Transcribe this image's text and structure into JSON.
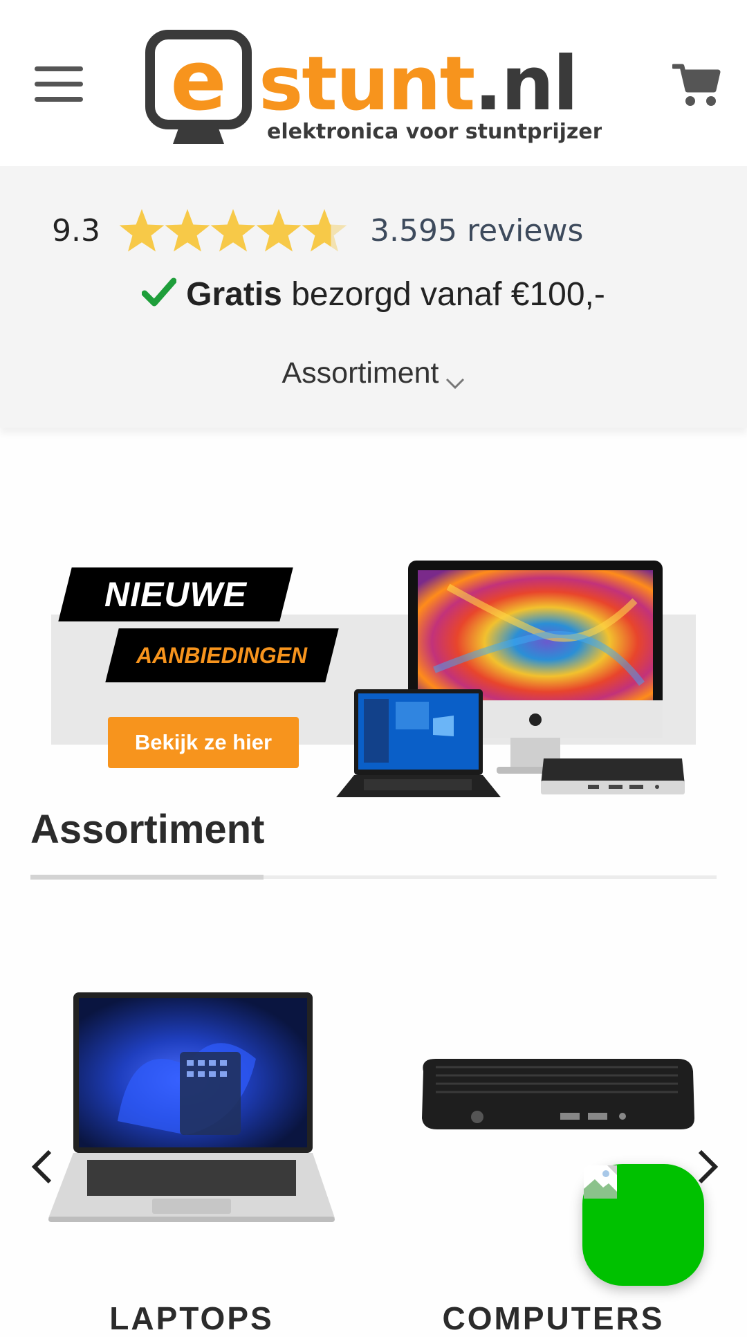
{
  "header": {
    "menu_icon": "hamburger-menu-icon",
    "logo": {
      "letter": "e",
      "name": "stunt.nl",
      "tagline": "elektronica voor stuntprijzen",
      "accent_color": "#f7941d",
      "dark_color": "#3a3a3a"
    },
    "cart_icon": "shopping-cart-icon"
  },
  "infobar": {
    "score": "9.3",
    "stars": 4.65,
    "star_color": "#f7c948",
    "reviews_text": "3.595 reviews",
    "shipping_bold": "Gratis",
    "shipping_rest": "bezorgd vanaf €100,-",
    "check_color": "#1e9e3a",
    "assortment_label": "Assortiment"
  },
  "banner": {
    "line1": "NIEUWE",
    "line2": "AANBIEDINGEN",
    "button": "Bekijk ze hier",
    "button_color": "#f7941d"
  },
  "section": {
    "title": "Assortiment"
  },
  "carousel": {
    "prev_icon": "chevron-left-icon",
    "next_icon": "chevron-right-icon",
    "items": [
      {
        "label": "LAPTOPS"
      },
      {
        "label": "COMPUTERS"
      }
    ]
  },
  "chat": {
    "color": "#00c100",
    "icon": "broken-image-icon"
  }
}
